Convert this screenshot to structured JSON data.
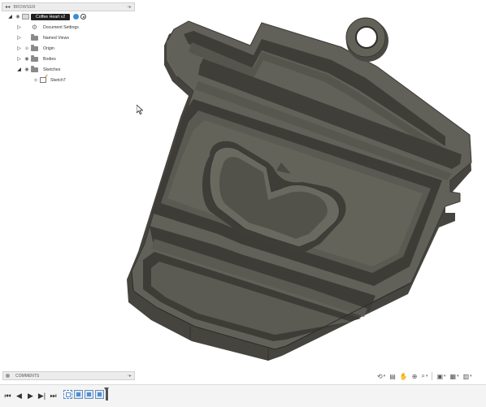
{
  "browser": {
    "header_label": "BROWSER",
    "root": {
      "label": "Coffee Heart v2"
    },
    "items": [
      {
        "label": "Document Settings",
        "icon": "gear-icon",
        "eye": false
      },
      {
        "label": "Named Views",
        "icon": "folder-icon",
        "eye": false
      },
      {
        "label": "Origin",
        "icon": "folder-icon",
        "eye": "dim"
      },
      {
        "label": "Bodies",
        "icon": "folder-icon",
        "eye": true
      },
      {
        "label": "Sketches",
        "icon": "folder-icon",
        "eye": true,
        "expanded": true
      },
      {
        "label": "Sketch7",
        "icon": "sketch-icon",
        "eye": "dim",
        "child": true
      }
    ]
  },
  "comments": {
    "label": "COMMENTS"
  },
  "colors": {
    "model_top": "#5f5e58",
    "model_side": "#45443f",
    "model_pocket": "#3d3c37",
    "accent_blue": "#3b8dd8"
  },
  "navbar": {
    "icons": [
      "orbit-icon",
      "pan-look-icon",
      "pan-icon",
      "zoom-icon",
      "fit-icon",
      "display-style-icon",
      "grid-icon",
      "viewports-icon"
    ]
  },
  "timeline": {
    "controls": [
      "go-to-start",
      "step-back",
      "play",
      "step-forward",
      "go-to-end"
    ],
    "items": [
      "sketch",
      "body",
      "body",
      "body"
    ]
  }
}
